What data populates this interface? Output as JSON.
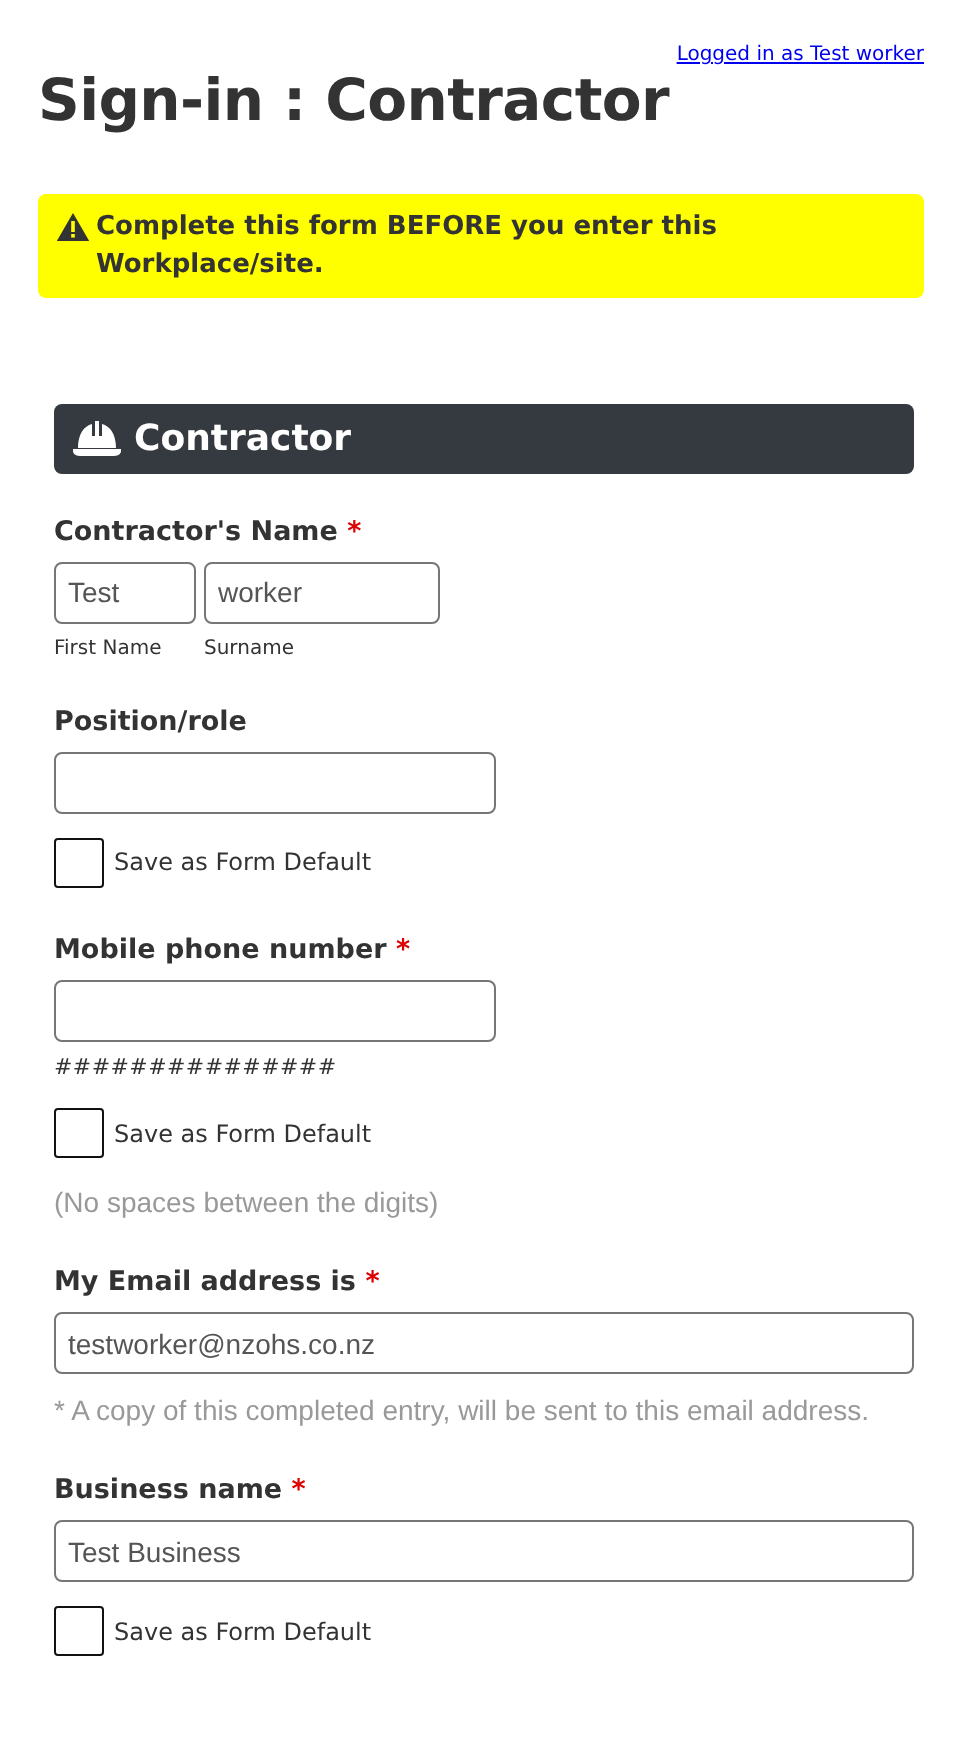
{
  "account_link": "Logged in as Test worker",
  "title": "Sign-in : Contractor",
  "alert": {
    "text": "Complete this form BEFORE you enter this Workplace/site."
  },
  "section": {
    "title": "Contractor"
  },
  "fields": [
    {
      "kind": "name",
      "label": "Contractor's Name",
      "required_mark": "*",
      "parts": [
        {
          "value": "Test",
          "caption": "First Name"
        },
        {
          "value": "worker",
          "caption": "Surname"
        }
      ]
    },
    {
      "kind": "short",
      "label": "Position/role",
      "save_default": {
        "label": "Save as Form Default",
        "checked": false
      }
    },
    {
      "kind": "short",
      "label": "Mobile phone number",
      "required_mark": "*",
      "mask": "###############",
      "save_default": {
        "label": "Save as Form Default",
        "checked": false
      },
      "hint": "(No spaces between the digits)"
    },
    {
      "kind": "wide",
      "label": "My Email address is",
      "required_mark": "*",
      "value": "testworker@nzohs.co.nz",
      "hint": "* A copy of this completed entry, will be sent to this email address."
    },
    {
      "kind": "wide",
      "label": "Business name",
      "required_mark": "*",
      "value": "Test Business",
      "save_default": {
        "label": "Save as Form Default",
        "checked": false
      }
    }
  ]
}
